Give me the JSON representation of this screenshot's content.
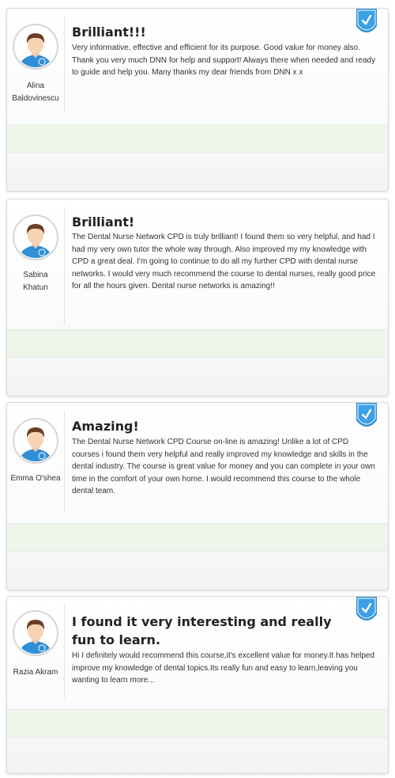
{
  "testimonials": [
    {
      "title": "Brilliant!!!",
      "author": "Alina Baldovinescu",
      "author_line1": "Alina",
      "author_line2": "Baldovinescu",
      "text": "Very informative, effective and efficient for its purpose. Good value for money also. Thank you very much DNN for help and support! Always there when needed and ready to guide and help you. Many thanks my dear friends from DNN x x",
      "verified": true
    },
    {
      "title": "Brilliant!",
      "author": "Sabina Khatun",
      "author_line1": "Sabina",
      "author_line2": "Khatun",
      "text": "The Dental Nurse Network CPD is truly brilliant! I found them so very helpful, and had I had my very own tutor the whole way through. Also improved my my knowledge with CPD a great deal. I'm going to continue to do all my further CPD with dental nurse networks. I would very much recommend the course to dental nurses, really good price for all the hours given. Dental nurse networks is amazing!!",
      "verified": false
    },
    {
      "title": "Amazing!",
      "author": "Emma O'shea",
      "author_line1": "Emma O'shea",
      "author_line2": "",
      "text": "The Dental Nurse Network CPD Course on-line is amazing! Unlike a lot of CPD courses i found them very helpful and really improved my knowledge and skills in the dental industry. The course is great value for money and you can complete in your own time in the comfort of your own home. I would recommend this course to the whole dental team.",
      "verified": true
    },
    {
      "title": "I found it very interesting and really fun to learn.",
      "author": "Razia Akram",
      "author_line1": "Razia Akram",
      "author_line2": "",
      "text": "Hi I definitely would recommend this course,it's excellent value for money.It has helped improve my knowledge of dental topics.Its really fun and easy to learn,leaving you wanting to learn more...",
      "verified": true
    }
  ],
  "colors": {
    "badge_blue": "#2f8fd6",
    "green_band": "#eef6ec",
    "avatar_shirt": "#2f8fd6"
  },
  "icons": {
    "avatar": "user-avatar-icon",
    "badge": "verified-check-badge-icon"
  }
}
